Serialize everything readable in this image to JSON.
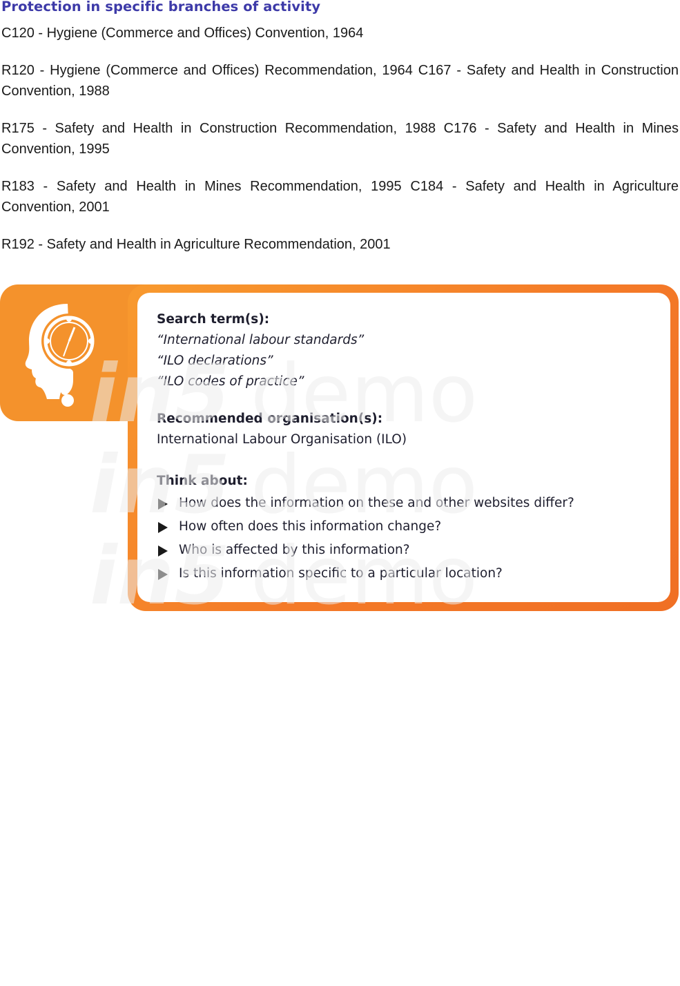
{
  "section": {
    "heading": "Protection in specific branches of activity",
    "paragraphs": [
      "C120 - Hygiene (Commerce and Offices) Convention, 1964",
      "R120 - Hygiene (Commerce and Offices) Recommendation, 1964 C167 - Safety and Health in Construction Convention, 1988",
      "R175 - Safety and Health in Construction Recommendation, 1988 C176 - Safety and Health in Mines Convention, 1995",
      "R183 - Safety and Health in Mines Recommendation, 1995 C184 - Safety and Health in Agriculture Convention, 2001",
      "R192 - Safety and Health in Agriculture Recommendation, 2001"
    ]
  },
  "research_box": {
    "search_label": "Search term(s):",
    "search_terms": [
      "“International labour standards”",
      "“ILO declarations”",
      "“ILO codes of practice”"
    ],
    "organisation_label": "Recommended organisation(s):",
    "organisation": "International Labour Organisation (ILO)",
    "think_label": "Think about:",
    "think_items": [
      "How does the information on these and other websites differ?",
      "How often does this information change?",
      "Who is affected by this information?",
      "Is this information specific to a particular location?"
    ],
    "icon": "head-clock-question-icon"
  },
  "watermark": {
    "brand": "in5",
    "word": "demo"
  },
  "colors": {
    "heading": "#3d3aa8",
    "orange": "#f4922c",
    "orange_dark": "#f06f24"
  }
}
